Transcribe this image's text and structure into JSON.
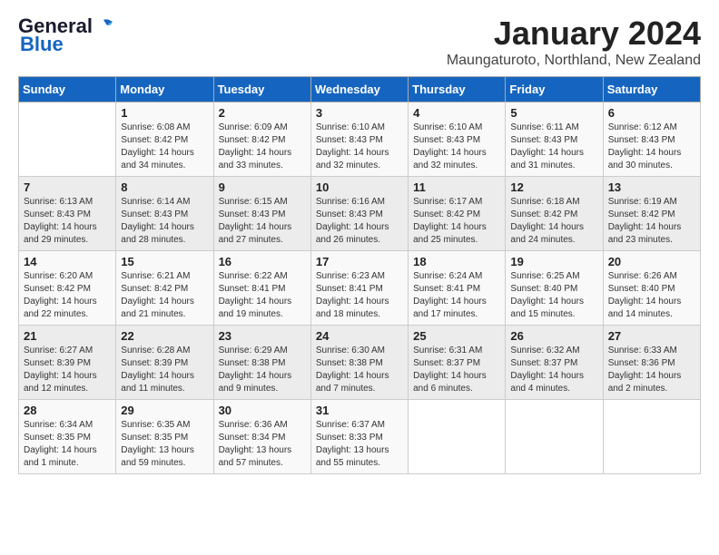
{
  "logo": {
    "line1": "General",
    "line2": "Blue"
  },
  "title": "January 2024",
  "subtitle": "Maungaturoto, Northland, New Zealand",
  "headers": [
    "Sunday",
    "Monday",
    "Tuesday",
    "Wednesday",
    "Thursday",
    "Friday",
    "Saturday"
  ],
  "weeks": [
    [
      {
        "day": "",
        "info": ""
      },
      {
        "day": "1",
        "info": "Sunrise: 6:08 AM\nSunset: 8:42 PM\nDaylight: 14 hours\nand 34 minutes."
      },
      {
        "day": "2",
        "info": "Sunrise: 6:09 AM\nSunset: 8:42 PM\nDaylight: 14 hours\nand 33 minutes."
      },
      {
        "day": "3",
        "info": "Sunrise: 6:10 AM\nSunset: 8:43 PM\nDaylight: 14 hours\nand 32 minutes."
      },
      {
        "day": "4",
        "info": "Sunrise: 6:10 AM\nSunset: 8:43 PM\nDaylight: 14 hours\nand 32 minutes."
      },
      {
        "day": "5",
        "info": "Sunrise: 6:11 AM\nSunset: 8:43 PM\nDaylight: 14 hours\nand 31 minutes."
      },
      {
        "day": "6",
        "info": "Sunrise: 6:12 AM\nSunset: 8:43 PM\nDaylight: 14 hours\nand 30 minutes."
      }
    ],
    [
      {
        "day": "7",
        "info": "Sunrise: 6:13 AM\nSunset: 8:43 PM\nDaylight: 14 hours\nand 29 minutes."
      },
      {
        "day": "8",
        "info": "Sunrise: 6:14 AM\nSunset: 8:43 PM\nDaylight: 14 hours\nand 28 minutes."
      },
      {
        "day": "9",
        "info": "Sunrise: 6:15 AM\nSunset: 8:43 PM\nDaylight: 14 hours\nand 27 minutes."
      },
      {
        "day": "10",
        "info": "Sunrise: 6:16 AM\nSunset: 8:43 PM\nDaylight: 14 hours\nand 26 minutes."
      },
      {
        "day": "11",
        "info": "Sunrise: 6:17 AM\nSunset: 8:42 PM\nDaylight: 14 hours\nand 25 minutes."
      },
      {
        "day": "12",
        "info": "Sunrise: 6:18 AM\nSunset: 8:42 PM\nDaylight: 14 hours\nand 24 minutes."
      },
      {
        "day": "13",
        "info": "Sunrise: 6:19 AM\nSunset: 8:42 PM\nDaylight: 14 hours\nand 23 minutes."
      }
    ],
    [
      {
        "day": "14",
        "info": "Sunrise: 6:20 AM\nSunset: 8:42 PM\nDaylight: 14 hours\nand 22 minutes."
      },
      {
        "day": "15",
        "info": "Sunrise: 6:21 AM\nSunset: 8:42 PM\nDaylight: 14 hours\nand 21 minutes."
      },
      {
        "day": "16",
        "info": "Sunrise: 6:22 AM\nSunset: 8:41 PM\nDaylight: 14 hours\nand 19 minutes."
      },
      {
        "day": "17",
        "info": "Sunrise: 6:23 AM\nSunset: 8:41 PM\nDaylight: 14 hours\nand 18 minutes."
      },
      {
        "day": "18",
        "info": "Sunrise: 6:24 AM\nSunset: 8:41 PM\nDaylight: 14 hours\nand 17 minutes."
      },
      {
        "day": "19",
        "info": "Sunrise: 6:25 AM\nSunset: 8:40 PM\nDaylight: 14 hours\nand 15 minutes."
      },
      {
        "day": "20",
        "info": "Sunrise: 6:26 AM\nSunset: 8:40 PM\nDaylight: 14 hours\nand 14 minutes."
      }
    ],
    [
      {
        "day": "21",
        "info": "Sunrise: 6:27 AM\nSunset: 8:39 PM\nDaylight: 14 hours\nand 12 minutes."
      },
      {
        "day": "22",
        "info": "Sunrise: 6:28 AM\nSunset: 8:39 PM\nDaylight: 14 hours\nand 11 minutes."
      },
      {
        "day": "23",
        "info": "Sunrise: 6:29 AM\nSunset: 8:38 PM\nDaylight: 14 hours\nand 9 minutes."
      },
      {
        "day": "24",
        "info": "Sunrise: 6:30 AM\nSunset: 8:38 PM\nDaylight: 14 hours\nand 7 minutes."
      },
      {
        "day": "25",
        "info": "Sunrise: 6:31 AM\nSunset: 8:37 PM\nDaylight: 14 hours\nand 6 minutes."
      },
      {
        "day": "26",
        "info": "Sunrise: 6:32 AM\nSunset: 8:37 PM\nDaylight: 14 hours\nand 4 minutes."
      },
      {
        "day": "27",
        "info": "Sunrise: 6:33 AM\nSunset: 8:36 PM\nDaylight: 14 hours\nand 2 minutes."
      }
    ],
    [
      {
        "day": "28",
        "info": "Sunrise: 6:34 AM\nSunset: 8:35 PM\nDaylight: 14 hours\nand 1 minute."
      },
      {
        "day": "29",
        "info": "Sunrise: 6:35 AM\nSunset: 8:35 PM\nDaylight: 13 hours\nand 59 minutes."
      },
      {
        "day": "30",
        "info": "Sunrise: 6:36 AM\nSunset: 8:34 PM\nDaylight: 13 hours\nand 57 minutes."
      },
      {
        "day": "31",
        "info": "Sunrise: 6:37 AM\nSunset: 8:33 PM\nDaylight: 13 hours\nand 55 minutes."
      },
      {
        "day": "",
        "info": ""
      },
      {
        "day": "",
        "info": ""
      },
      {
        "day": "",
        "info": ""
      }
    ]
  ]
}
